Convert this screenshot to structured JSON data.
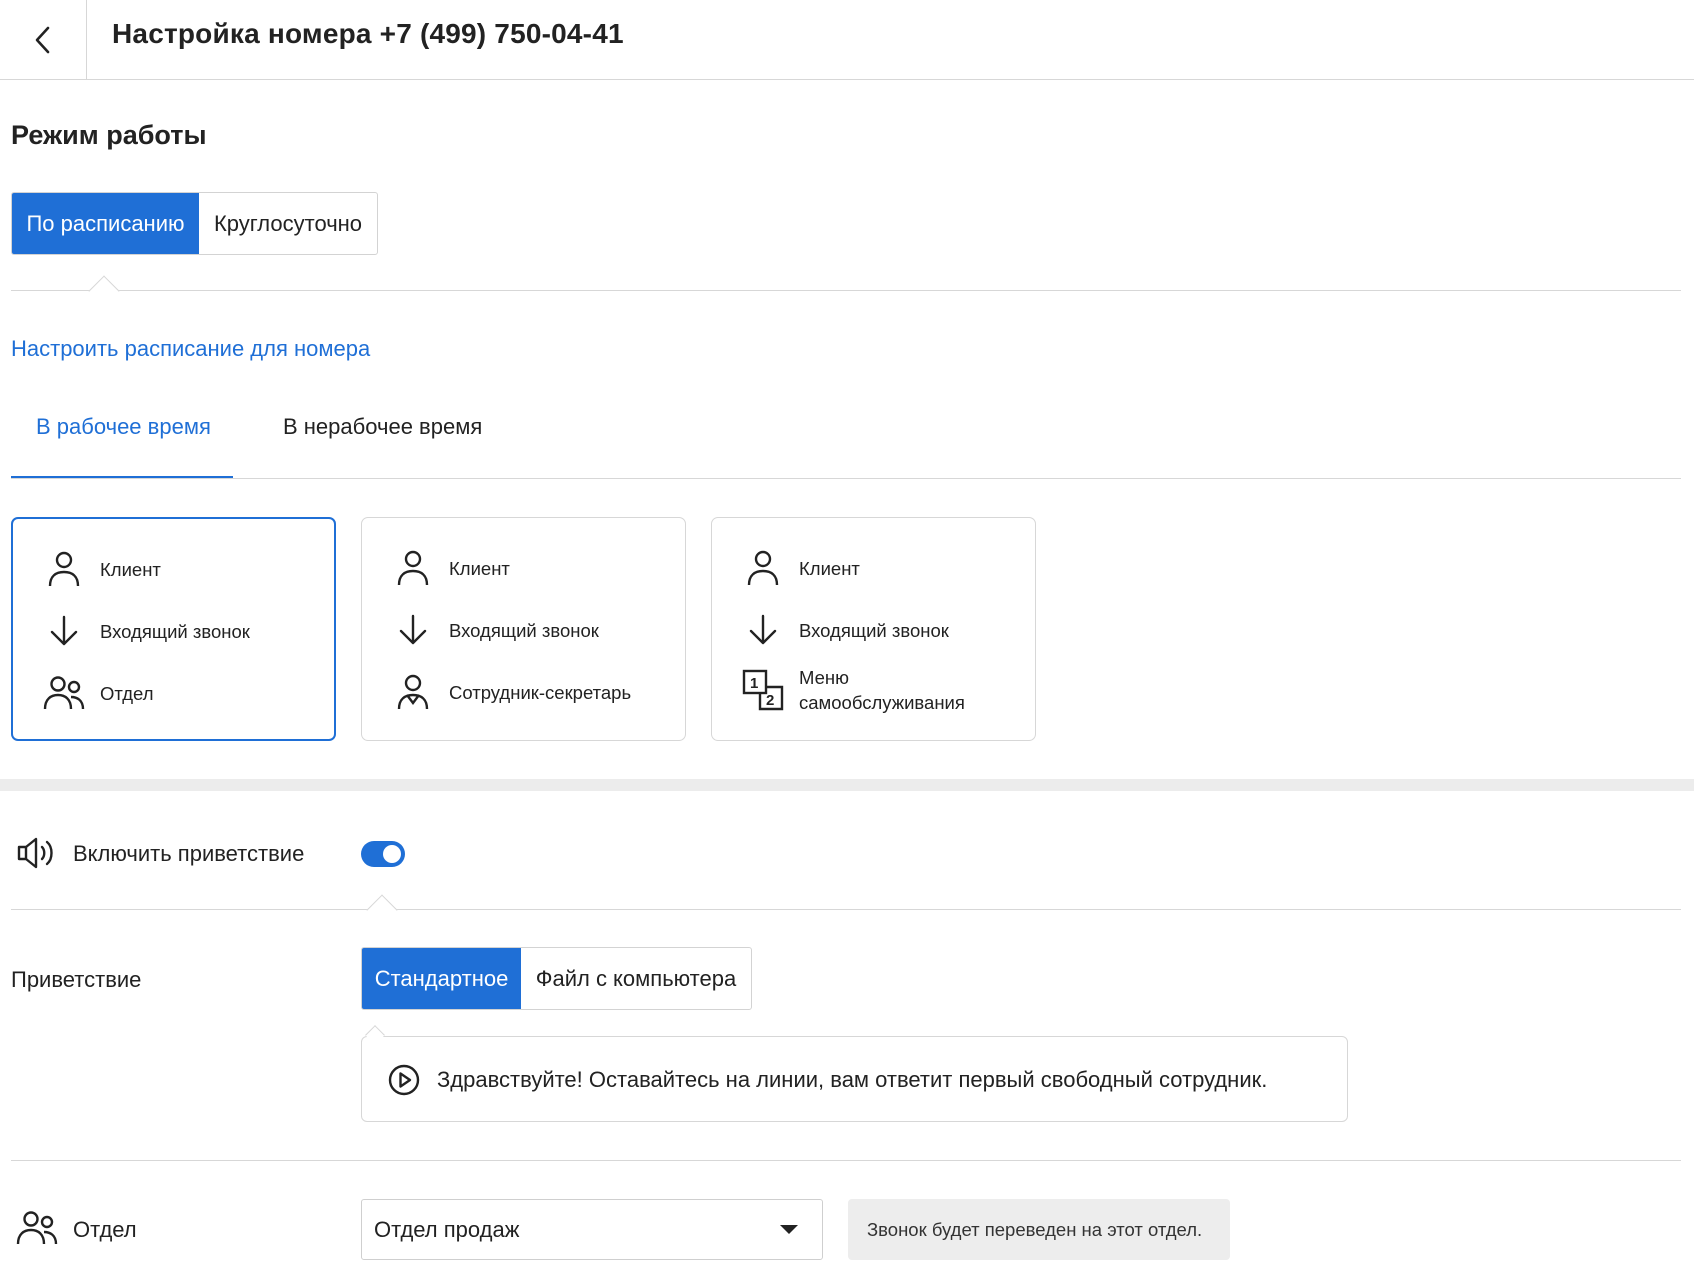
{
  "header": {
    "title": "Настройка номера +7 (499) 750-04-41",
    "back_icon": "chevron-left-icon"
  },
  "mode": {
    "title": "Режим работы",
    "options": [
      {
        "label": "По расписанию",
        "active": true
      },
      {
        "label": "Круглосуточно",
        "active": false
      }
    ],
    "schedule_link": "Настроить расписание для номера"
  },
  "tabs": [
    {
      "label": "В рабочее время",
      "active": true
    },
    {
      "label": "В нерабочее время",
      "active": false
    }
  ],
  "scenarios": [
    {
      "selected": true,
      "steps": [
        {
          "icon": "user-icon",
          "label": "Клиент"
        },
        {
          "icon": "arrow-down-icon",
          "label": "Входящий звонок"
        },
        {
          "icon": "group-icon",
          "label": "Отдел"
        }
      ]
    },
    {
      "selected": false,
      "steps": [
        {
          "icon": "user-icon",
          "label": "Клиент"
        },
        {
          "icon": "arrow-down-icon",
          "label": "Входящий звонок"
        },
        {
          "icon": "secretary-icon",
          "label": "Сотрудник-секретарь"
        }
      ]
    },
    {
      "selected": false,
      "steps": [
        {
          "icon": "user-icon",
          "label": "Клиент"
        },
        {
          "icon": "arrow-down-icon",
          "label": "Входящий звонок"
        },
        {
          "icon": "ivr-menu-icon",
          "label": "Меню самообслуживания",
          "line1": "Меню",
          "line2": "самообслуживания"
        }
      ]
    }
  ],
  "greeting_toggle": {
    "icon": "speaker-icon",
    "label": "Включить приветствие",
    "enabled": true
  },
  "greeting": {
    "label": "Приветствие",
    "options": [
      {
        "label": "Стандартное",
        "active": true
      },
      {
        "label": "Файл с компьютера",
        "active": false
      }
    ],
    "play_icon": "play-icon",
    "text": "Здравствуйте! Оставайтесь на линии, вам ответит первый свободный сотрудник."
  },
  "department": {
    "icon": "group-icon",
    "label": "Отдел",
    "selected": "Отдел продаж",
    "hint": "Звонок будет переведен на этот отдел."
  },
  "colors": {
    "accent": "#1f6fd6",
    "border": "#d7d7d7",
    "band": "#ececec",
    "hint_bg": "#ededed"
  }
}
